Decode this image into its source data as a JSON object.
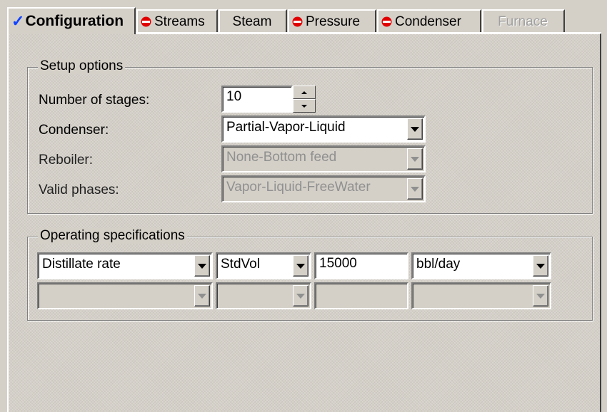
{
  "tabs": [
    {
      "label": "Configuration",
      "state": "complete",
      "icon": "checkmark-icon",
      "active": true
    },
    {
      "label": "Streams",
      "state": "required",
      "icon": "required-input-icon"
    },
    {
      "label": "Steam",
      "state": "normal"
    },
    {
      "label": "Pressure",
      "state": "required",
      "icon": "required-input-icon"
    },
    {
      "label": "Condenser",
      "state": "required",
      "icon": "required-input-icon"
    },
    {
      "label": "Furnace",
      "state": "disabled"
    }
  ],
  "setup": {
    "title": "Setup options",
    "num_stages_label": "Number of stages:",
    "num_stages_value": "10",
    "condenser_label": "Condenser:",
    "condenser_value": "Partial-Vapor-Liquid",
    "reboiler_label": "Reboiler:",
    "reboiler_value": "None-Bottom feed",
    "phases_label": "Valid phases:",
    "phases_value": "Vapor-Liquid-FreeWater"
  },
  "operating": {
    "title": "Operating specifications",
    "row1": {
      "spec": "Distillate rate",
      "basis": "StdVol",
      "value": "15000",
      "units": "bbl/day"
    },
    "row2": {
      "spec": "",
      "basis": "",
      "value": "",
      "units": ""
    }
  },
  "colors": {
    "check": "#1144ff",
    "required": "#e00000",
    "face": "#d4d0c8"
  }
}
